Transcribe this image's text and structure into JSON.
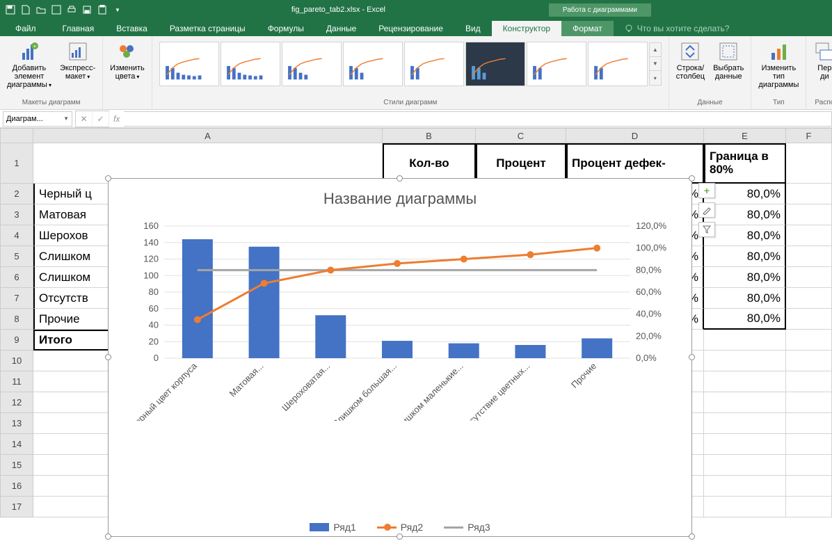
{
  "title_file": "fig_pareto_tab2.xlsx  -  Excel",
  "chart_tools_label": "Работа с диаграммами",
  "tabs": {
    "file": "Файл",
    "home": "Главная",
    "insert": "Вставка",
    "layout": "Разметка страницы",
    "formulas": "Формулы",
    "data": "Данные",
    "review": "Рецензирование",
    "view": "Вид",
    "design": "Конструктор",
    "format": "Формат"
  },
  "tell_me": "Что вы хотите сделать?",
  "ribbon": {
    "add_element": "Добавить элемент диаграммы",
    "quick_layout": "Экспресс-макет",
    "layouts_label": "Макеты диаграмм",
    "change_colors": "Изменить цвета",
    "styles_label": "Стили диаграмм",
    "switch_rc": "Строка/столбец",
    "select_data": "Выбрать данные",
    "data_label": "Данные",
    "change_type": "Изменить тип диаграммы",
    "type_label": "Тип",
    "move": "Пер",
    "move2": "ди",
    "placement_label": "Распо"
  },
  "name_box": "Диаграм...",
  "col_headers": [
    "A",
    "B",
    "C",
    "D",
    "E",
    "F"
  ],
  "row_headers": [
    "1",
    "2",
    "3",
    "4",
    "5",
    "6",
    "7",
    "8",
    "9",
    "10",
    "11",
    "12",
    "13",
    "14",
    "15",
    "16",
    "17"
  ],
  "headers": {
    "B": "Кол-во",
    "C": "Процент",
    "D": "Процент дефек-",
    "E1": "Граница",
    "E2": "в 80%"
  },
  "rows_A": [
    "Черный ц",
    "Матовая",
    "Шерохов",
    "Слишком",
    "Слишком",
    "Отсутств",
    "Прочие",
    "Итого"
  ],
  "rows_E": [
    "80,0%",
    "80,0%",
    "80,0%",
    "80,0%",
    "80,0%",
    "80,0%",
    "80,0%"
  ],
  "partial_D": "%",
  "chart_data": {
    "type": "pareto",
    "title": "Название диаграммы",
    "categories": [
      "Черный цвет корпуса",
      "Матовая...",
      "Шероховатая...",
      "Слишком большая...",
      "Слишком маленькие...",
      "Отсутствие цветных...",
      "Прочие"
    ],
    "series": [
      {
        "name": "Ряд1",
        "type": "bar",
        "values": [
          144,
          135,
          52,
          21,
          18,
          16,
          24
        ],
        "axis": "left",
        "color": "#4472C4"
      },
      {
        "name": "Ряд2",
        "type": "line",
        "values": [
          35,
          68,
          80,
          86,
          90,
          94,
          100
        ],
        "axis": "right",
        "color": "#ED7D31"
      },
      {
        "name": "Ряд3",
        "type": "line",
        "values": [
          80,
          80,
          80,
          80,
          80,
          80,
          80
        ],
        "axis": "right",
        "color": "#A5A5A5"
      }
    ],
    "y_left": {
      "min": 0,
      "max": 160,
      "step": 20
    },
    "y_right": {
      "min": 0,
      "max": 120,
      "step": 20,
      "format": "0,0%"
    },
    "legend": [
      "Ряд1",
      "Ряд2",
      "Ряд3"
    ]
  },
  "colors": {
    "bar": "#4472C4",
    "line": "#ED7D31",
    "ref": "#A5A5A5",
    "excel": "#217346"
  }
}
